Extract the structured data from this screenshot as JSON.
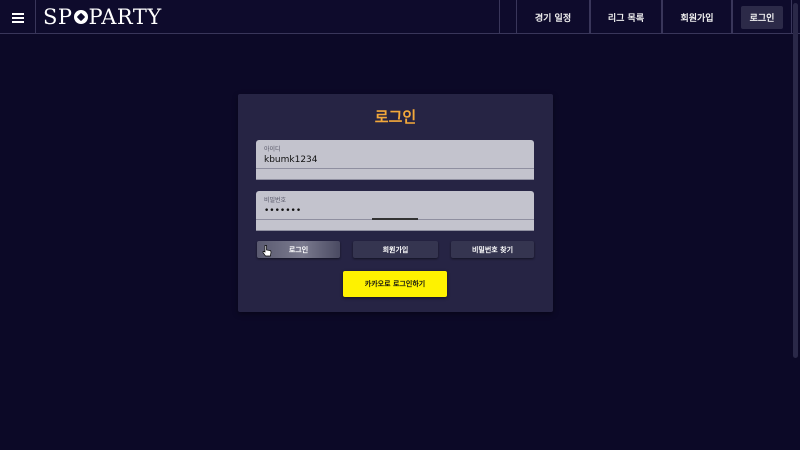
{
  "header": {
    "logo_text_left": "SP",
    "logo_text_right": "PARTY",
    "nav": [
      {
        "label": "경기 일정"
      },
      {
        "label": "리그 목록"
      },
      {
        "label": "회원가입"
      },
      {
        "label": "로그인"
      }
    ]
  },
  "login": {
    "title": "로그인",
    "id_label": "아이디",
    "id_value": "kbumk1234",
    "pw_label": "비밀번호",
    "pw_value": "1234567",
    "login_button": "로그인",
    "signup_button": "회원가입",
    "find_pw_button": "비밀번호 찾기",
    "kakao_button": "카카오로 로그인하기"
  },
  "colors": {
    "background": "#0c0927",
    "title_accent": "#f2a83b",
    "kakao": "#fef200"
  },
  "icons": [
    "menu-icon",
    "soccer-ball-icon",
    "pointer-cursor-icon"
  ]
}
